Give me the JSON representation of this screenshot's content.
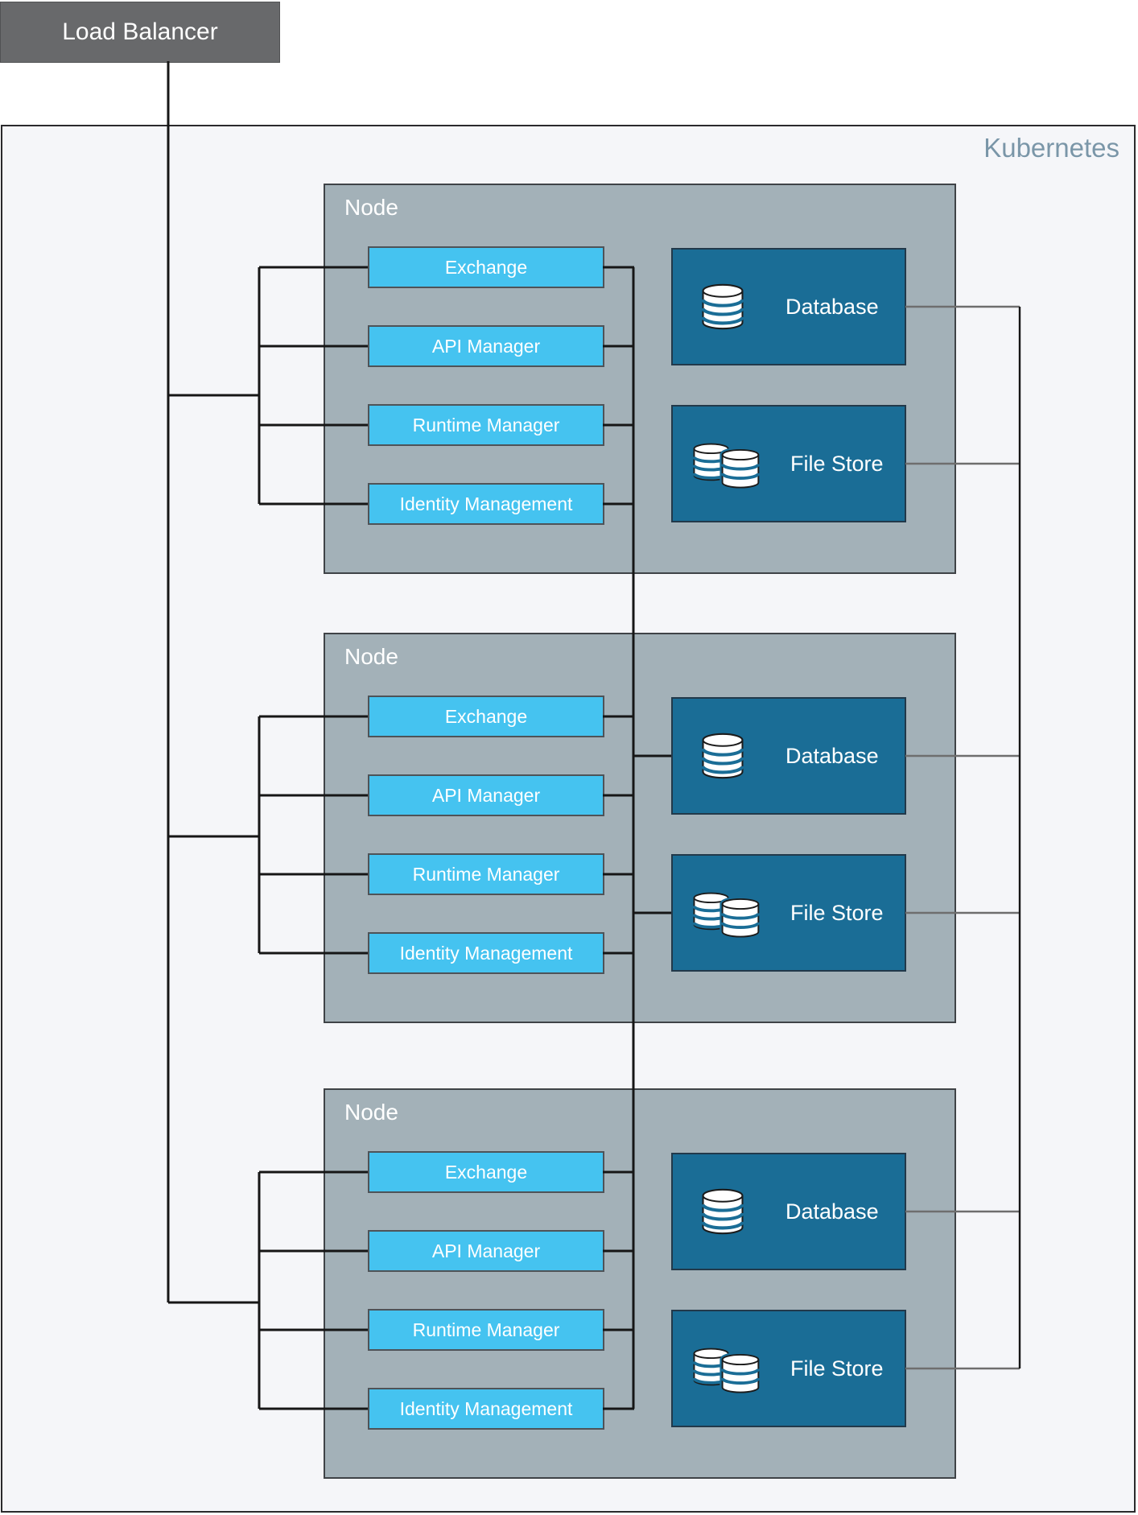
{
  "load_balancer": {
    "label": "Load Balancer"
  },
  "cluster": {
    "label": "Kubernetes"
  },
  "nodes": [
    {
      "label": "Node",
      "services": [
        "Exchange",
        "API Manager",
        "Runtime Manager",
        "Identity Management"
      ],
      "stores": [
        {
          "label": "Database",
          "icon": "database-icon"
        },
        {
          "label": "File Store",
          "icon": "file-store-icon"
        }
      ]
    },
    {
      "label": "Node",
      "services": [
        "Exchange",
        "API Manager",
        "Runtime Manager",
        "Identity Management"
      ],
      "stores": [
        {
          "label": "Database",
          "icon": "database-icon"
        },
        {
          "label": "File Store",
          "icon": "file-store-icon"
        }
      ]
    },
    {
      "label": "Node",
      "services": [
        "Exchange",
        "API Manager",
        "Runtime Manager",
        "Identity Management"
      ],
      "stores": [
        {
          "label": "Database",
          "icon": "database-icon"
        },
        {
          "label": "File Store",
          "icon": "file-store-icon"
        }
      ]
    }
  ],
  "colors": {
    "service_blue": "#45c3f0",
    "store_teal": "#1a6d96",
    "node_gray": "#a3b1b8",
    "cluster_bg": "#f5f6f9",
    "lb_gray": "#68696b",
    "cluster_label": "#7a96a8",
    "line_black": "#161616",
    "line_gray": "#6e6e6e"
  }
}
